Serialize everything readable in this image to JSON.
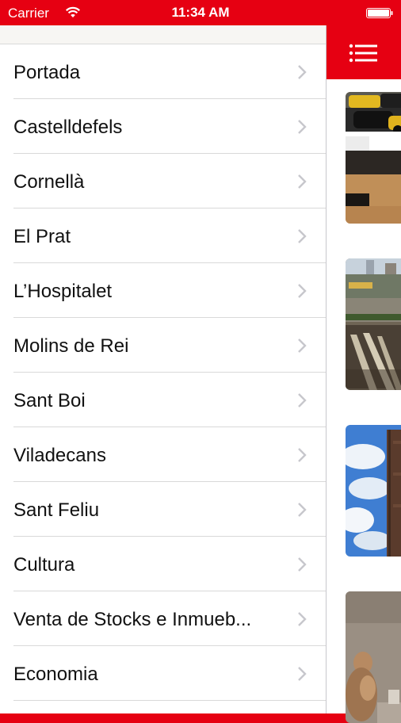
{
  "status_bar": {
    "carrier": "Carrier",
    "time": "11:34 AM",
    "wifi_icon": "wifi-icon",
    "battery_icon": "battery-icon"
  },
  "theme": {
    "accent": "#e60012",
    "menu_background": "#ffffff",
    "separator": "#d9d9d9",
    "chevron": "#c7c7cc"
  },
  "top_bar": {
    "menu_icon": "list-menu-icon"
  },
  "menu": {
    "items": [
      {
        "label": "Portada"
      },
      {
        "label": "Castelldefels"
      },
      {
        "label": "Cornellà"
      },
      {
        "label": "El Prat"
      },
      {
        "label": "L’Hospitalet"
      },
      {
        "label": "Molins de Rei"
      },
      {
        "label": "Sant Boi"
      },
      {
        "label": "Viladecans"
      },
      {
        "label": "Sant Feliu"
      },
      {
        "label": "Cultura"
      },
      {
        "label": "Venta de Stocks e Inmueb..."
      },
      {
        "label": "Economia"
      }
    ]
  },
  "articles": [
    {
      "image": "street-taxis-photo"
    },
    {
      "image": "construction-site-photo"
    },
    {
      "image": "brick-tower-sky-photo"
    },
    {
      "image": "sculpture-photo"
    }
  ]
}
